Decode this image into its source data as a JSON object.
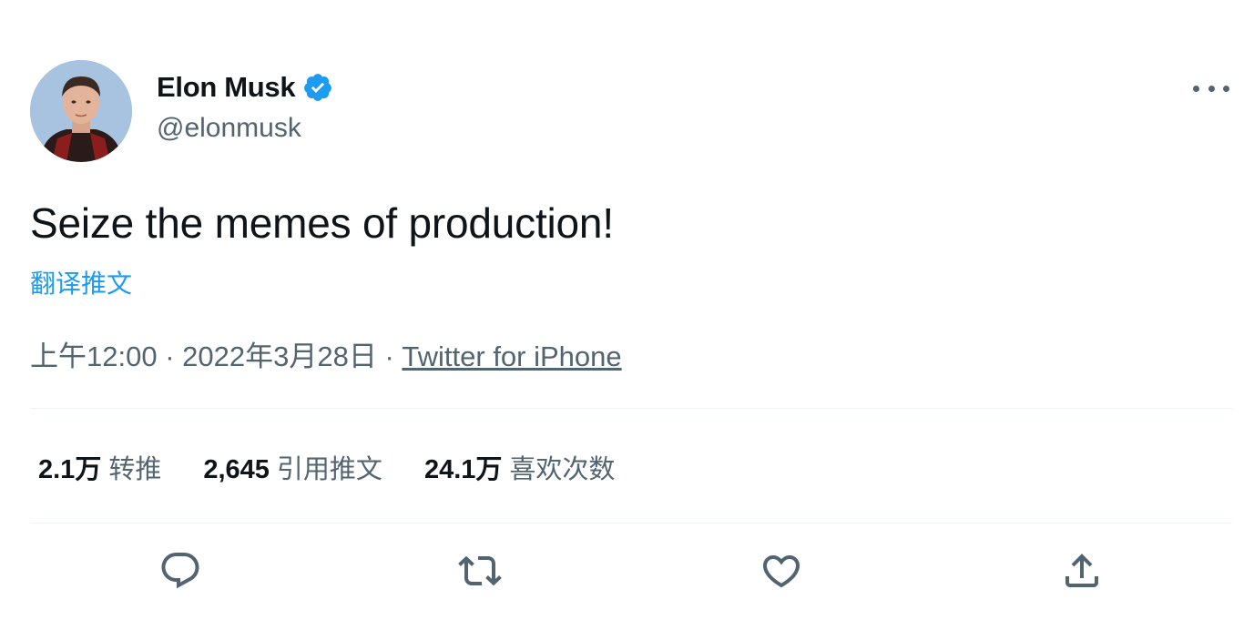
{
  "author": {
    "display_name": "Elon Musk",
    "handle": "@elonmusk",
    "verified": true,
    "verified_color": "#1d9bf0"
  },
  "tweet": {
    "text": "Seize the memes of production!",
    "translate_label": "翻译推文",
    "time": "上午12:00",
    "separator": "·",
    "date": "2022年3月28日",
    "source": "Twitter for iPhone"
  },
  "stats": {
    "retweets_count": "2.1万",
    "retweets_label": "转推",
    "quotes_count": "2,645",
    "quotes_label": "引用推文",
    "likes_count": "24.1万",
    "likes_label": "喜欢次数"
  },
  "icons": {
    "more": "more-horizontal-icon",
    "reply": "reply-icon",
    "retweet": "retweet-icon",
    "like": "heart-icon",
    "share": "share-icon"
  },
  "colors": {
    "text": "#0f1419",
    "secondary": "#536471",
    "link": "#1d9bf0",
    "divider": "#eff3f4"
  }
}
